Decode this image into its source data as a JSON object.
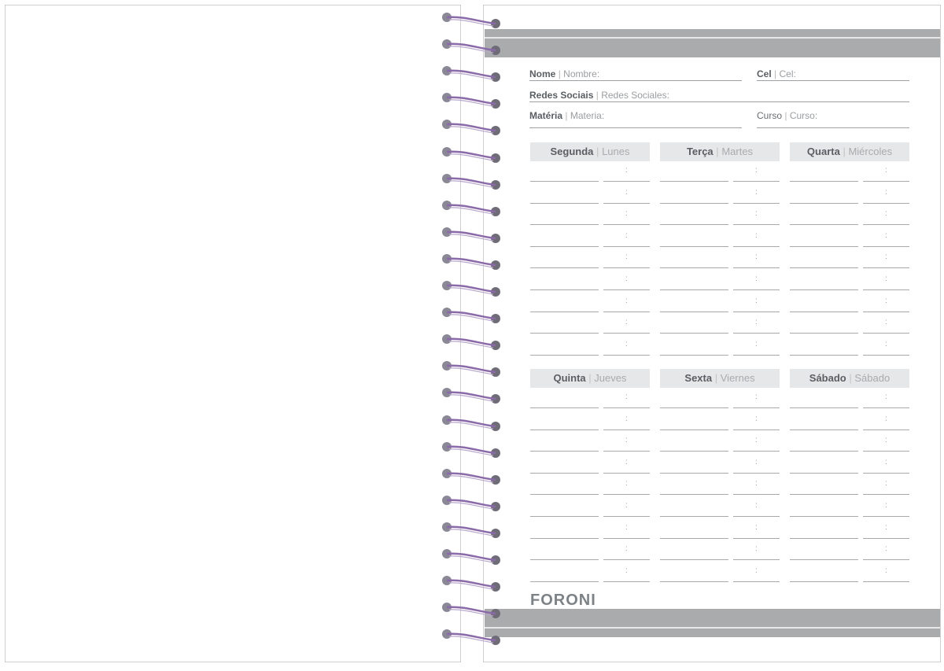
{
  "notebook": {
    "brand": "FORONI",
    "fields": {
      "nome": {
        "pt": "Nome",
        "es": "Nombre:"
      },
      "cel": {
        "pt": "Cel",
        "es": "Cel:"
      },
      "redes": {
        "pt": "Redes Sociais",
        "es": "Redes Sociales:"
      },
      "materia": {
        "pt": "Matéria",
        "es": "Materia:"
      },
      "curso": {
        "pt": "Curso",
        "es": "Curso:"
      }
    },
    "days": [
      {
        "pt": "Segunda",
        "es": "Lunes"
      },
      {
        "pt": "Terça",
        "es": "Martes"
      },
      {
        "pt": "Quarta",
        "es": "Miércoles"
      },
      {
        "pt": "Quinta",
        "es": "Jueves"
      },
      {
        "pt": "Sexta",
        "es": "Viernes"
      },
      {
        "pt": "Sábado",
        "es": "Sábado"
      }
    ],
    "separator": "|",
    "time_separator": ":",
    "colors": {
      "band": "#a9abad",
      "header_bg": "#e6e7e8",
      "coil": "#8a6aa8",
      "text_dark": "#5a5e63",
      "text_light": "#9a9da0"
    }
  }
}
